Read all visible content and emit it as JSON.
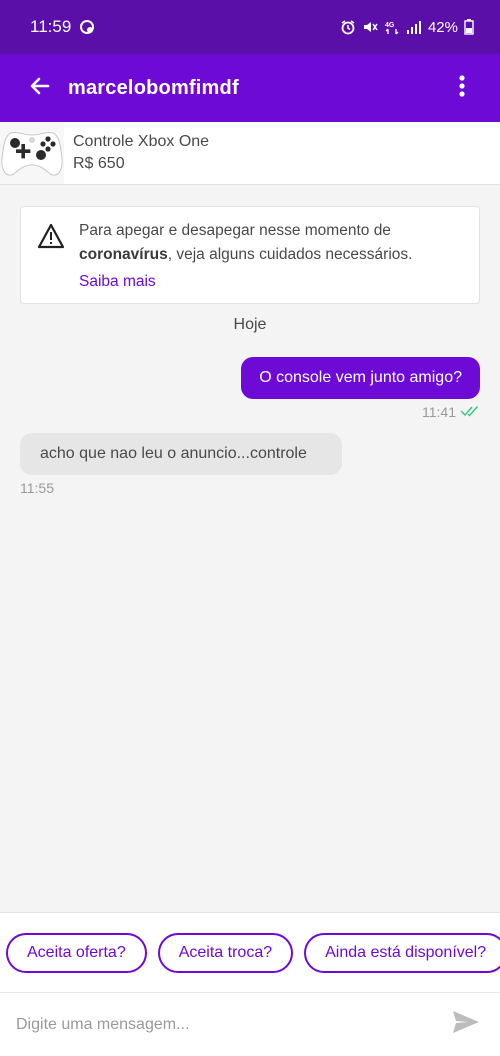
{
  "status": {
    "time": "11:59",
    "battery": "42%",
    "icons": [
      "alarm-icon",
      "mute-icon",
      "4g-icon",
      "signal-icon",
      "battery-icon"
    ]
  },
  "header": {
    "title": "marcelobomfimdf",
    "back_icon": "arrow-left-icon",
    "more_icon": "more-vert-icon",
    "bg_color": "#6e0ad6"
  },
  "product": {
    "name": "Controle Xbox One",
    "price": "R$ 650",
    "thumb_icon": "xbox-controller-image"
  },
  "notice": {
    "text_before": "Para apegar e desapegar nesse momento de ",
    "text_bold": "coronavírus",
    "text_after": ", veja alguns cuidados necessários.",
    "link": "Saiba mais",
    "icon": "warning-icon"
  },
  "chat": {
    "day_label": "Hoje",
    "messages": [
      {
        "direction": "out",
        "text": "O console vem junto amigo?",
        "time": "11:41",
        "status_icon": "double-check-icon"
      },
      {
        "direction": "in",
        "text": "acho que nao leu o anuncio...controle",
        "time": "11:55"
      }
    ]
  },
  "quick_replies": [
    "Aceita oferta?",
    "Aceita troca?",
    "Ainda está disponível?"
  ],
  "composer": {
    "placeholder": "Digite uma mensagem...",
    "send_icon": "send-icon"
  },
  "colors": {
    "accent": "#6e0ad6",
    "status_bar": "#5a10a8",
    "read_check": "#3cc47c"
  }
}
